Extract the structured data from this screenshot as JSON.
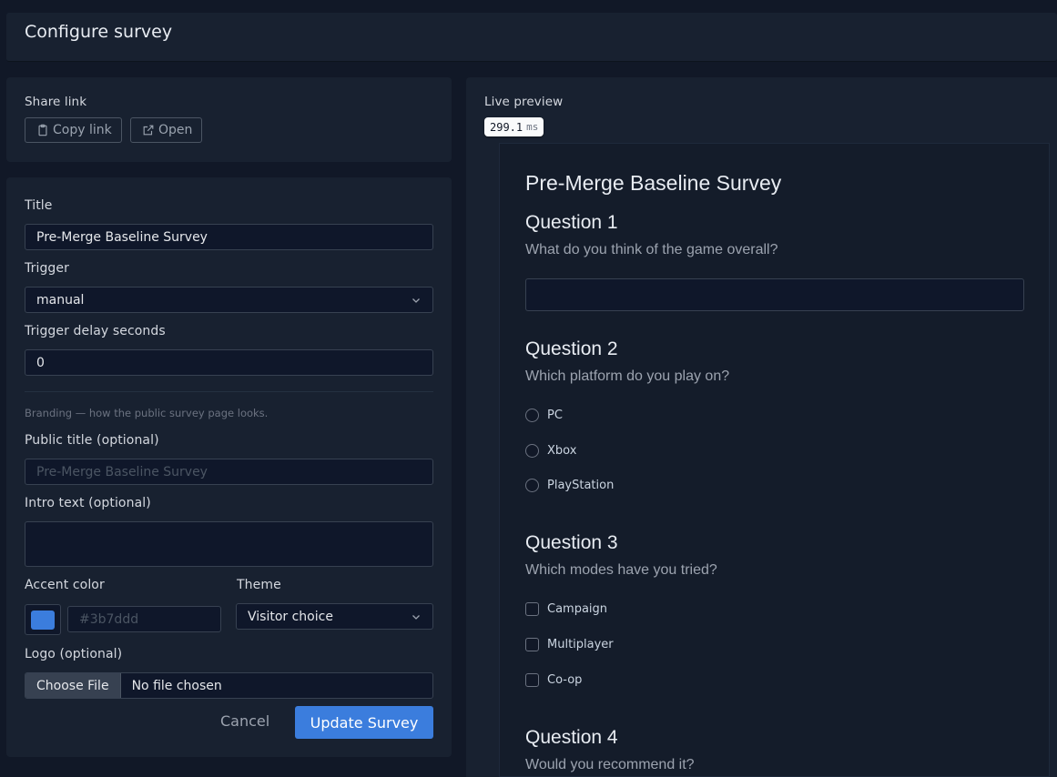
{
  "header": {
    "title": "Configure survey"
  },
  "share": {
    "label": "Share link",
    "copy_label": "Copy link",
    "open_label": "Open"
  },
  "form": {
    "title_label": "Title",
    "title_value": "Pre-Merge Baseline Survey",
    "trigger_label": "Trigger",
    "trigger_value": "manual",
    "delay_label": "Trigger delay seconds",
    "delay_value": "0",
    "branding_hint": "Branding — how the public survey page looks.",
    "public_title_label": "Public title (optional)",
    "public_title_placeholder": "Pre-Merge Baseline Survey",
    "intro_label": "Intro text (optional)",
    "intro_value": "",
    "accent_label": "Accent color",
    "accent_color": "#3b7ddd",
    "accent_placeholder": "#3b7ddd",
    "theme_label": "Theme",
    "theme_value": "Visitor choice",
    "logo_label": "Logo (optional)",
    "choose_file_label": "Choose File",
    "no_file_label": "No file chosen",
    "cancel_label": "Cancel",
    "update_label": "Update Survey"
  },
  "preview": {
    "label": "Live preview",
    "timing_value": "299.1",
    "timing_unit": "ms",
    "survey_title": "Pre-Merge Baseline Survey",
    "questions": [
      {
        "heading": "Question 1",
        "text": "What do you think of the game overall?"
      },
      {
        "heading": "Question 2",
        "text": "Which platform do you play on?",
        "options": [
          "PC",
          "Xbox",
          "PlayStation"
        ]
      },
      {
        "heading": "Question 3",
        "text": "Which modes have you tried?",
        "options": [
          "Campaign",
          "Multiplayer",
          "Co-op"
        ]
      },
      {
        "heading": "Question 4",
        "text": "Would you recommend it?"
      }
    ]
  }
}
